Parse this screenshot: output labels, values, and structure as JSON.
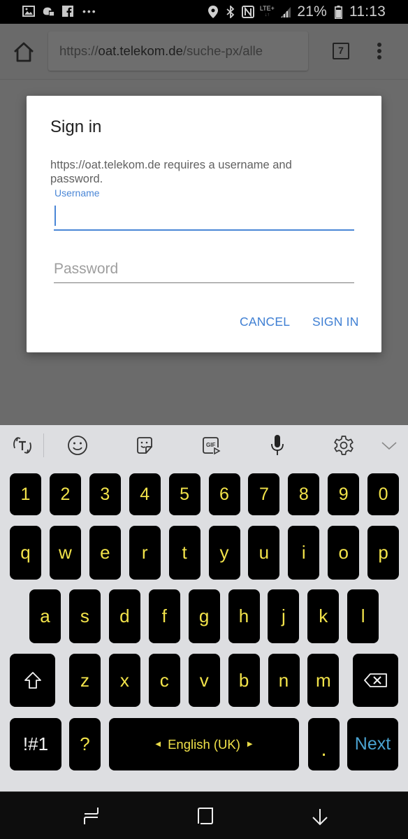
{
  "status_bar": {
    "left_icons": [
      "gallery-icon",
      "game-controller-icon",
      "facebook-icon",
      "more-notifications-icon"
    ],
    "right_icons": [
      "location-icon",
      "bluetooth-icon",
      "nfc-icon",
      "lte-plus-icon",
      "signal-icon"
    ],
    "network_label": "LTE+",
    "battery_percent": "21%",
    "time": "11:13"
  },
  "browser": {
    "url_scheme": "https://",
    "url_host": "oat.telekom.de",
    "url_path": "/suche-px/alle",
    "tab_count": "7"
  },
  "dialog": {
    "title": "Sign in",
    "message": "https://oat.telekom.de requires a username and password.",
    "username_label": "Username",
    "username_value": "",
    "password_placeholder": "Password",
    "password_value": "",
    "cancel_label": "CANCEL",
    "signin_label": "SIGN IN",
    "accent_color": "#4a86d6"
  },
  "keyboard": {
    "toolbar": [
      "text-translate-icon",
      "emoji-icon",
      "sticker-icon",
      "gif-icon",
      "microphone-icon",
      "settings-gear-icon",
      "collapse-chevron-icon"
    ],
    "rows": [
      [
        "1",
        "2",
        "3",
        "4",
        "5",
        "6",
        "7",
        "8",
        "9",
        "0"
      ],
      [
        "q",
        "w",
        "e",
        "r",
        "t",
        "y",
        "u",
        "i",
        "o",
        "p"
      ],
      [
        "a",
        "s",
        "d",
        "f",
        "g",
        "h",
        "j",
        "k",
        "l"
      ],
      [
        "z",
        "x",
        "c",
        "v",
        "b",
        "n",
        "m"
      ]
    ],
    "symbols_label": "!#1",
    "question_label": "?",
    "space_label": "English (UK)",
    "period_label": ".",
    "action_label": "Next",
    "key_color": "#000000",
    "key_text_color": "#f2e34a",
    "action_text_color": "#4aa3d1"
  },
  "nav_bar": {
    "buttons": [
      "recent-apps",
      "home",
      "back"
    ]
  }
}
